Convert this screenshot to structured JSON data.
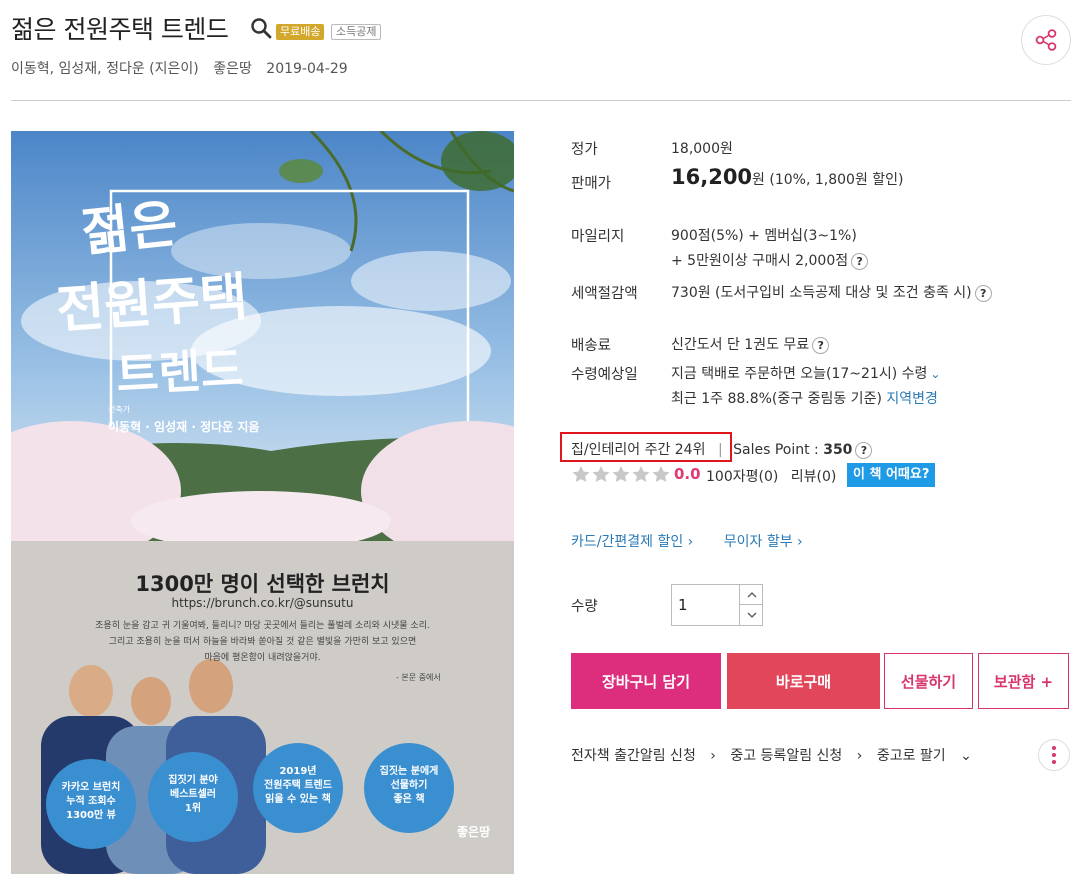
{
  "header": {
    "title": "젊은 전원주택 트렌드",
    "badge_free": "무료배송",
    "badge_tax": "소득공제",
    "authors": "이동혁, 임성재, 정다운 (지은이)",
    "publisher": "좋은땅",
    "date": "2019-04-29"
  },
  "cover": {
    "title_line1": "젊은",
    "title_line2": "전원주택",
    "title_line3": "트렌드",
    "author_small": "건축가",
    "authors": "이동혁 · 임성재 · 정다운 지음",
    "headline": "1300만 명이 선택한 브런치",
    "url": "https://brunch.co.kr/@sunsutu",
    "quote1": "조용히 눈을 감고 귀 기울여봐, 들리니? 마당 곳곳에서 들리는 풀벌레 소리와 시냇물 소리.",
    "quote2": "그리고 조용히 눈을 떠서 하늘을 바라봐 쏟아질 것 같은 별빛을 가만히 보고 있으면",
    "quote3": "마음에 평온함이 내려앉을거야.",
    "quote_src": "- 본문 중에서",
    "badge1": [
      "카카오 브런치",
      "누적 조회수",
      "1300만 뷰"
    ],
    "badge2": [
      "집짓기 분야",
      "베스트셀러",
      "1위"
    ],
    "badge3": [
      "2019년",
      "전원주택 트렌드",
      "읽을 수 있는 책"
    ],
    "badge4": [
      "집짓는 분에게",
      "선물하기",
      "좋은 책"
    ],
    "logo": "좋은땅"
  },
  "price": {
    "list_label": "정가",
    "list_value": "18,000원",
    "sale_label": "판매가",
    "sale_amount": "16,200",
    "sale_unit": "원",
    "sale_discount": "(10%, 1,800원 할인)"
  },
  "mileage": {
    "label": "마일리지",
    "line1": "900점(5%) + 멤버십(3~1%)",
    "line2": "+ 5만원이상 구매시 2,000점"
  },
  "tax": {
    "label": "세액절감액",
    "value": "730원 (도서구입비 소득공제 대상 및 조건 충족 시)"
  },
  "shipping": {
    "fee_label": "배송료",
    "fee_value": "신간도서 단 1권도 무료",
    "eta_label": "수령예상일",
    "eta_value": "지금 택배로 주문하면 오늘(17~21시) 수령",
    "recent": "최근 1주 88.8%(중구 중림동 기준)",
    "change_region": "지역변경"
  },
  "rank": {
    "category": "집/인테리어 주간 24위",
    "sales_point_label": "Sales Point :",
    "sales_point_value": "350"
  },
  "rating": {
    "score": "0.0",
    "reviews_100": "100자평(0)",
    "reviews": "리뷰(0)",
    "how_button": "이 책 어때요?"
  },
  "discounts": {
    "card": "카드/간편결제 할인",
    "installment": "무이자 할부"
  },
  "quantity": {
    "label": "수량",
    "value": "1"
  },
  "actions": {
    "cart": "장바구니 담기",
    "buy": "바로구매",
    "gift": "선물하기",
    "keep": "보관함 +"
  },
  "bottom": {
    "ebook_alert": "전자책 출간알림 신청",
    "used_alert": "중고 등록알림 신청",
    "sell_used": "중고로 팔기"
  },
  "colors": {
    "accent": "#dd2d7d",
    "buy": "#e2465a",
    "link": "#2a7ab8",
    "badge": "#d3a72b",
    "info_button": "#1e9ae6"
  }
}
